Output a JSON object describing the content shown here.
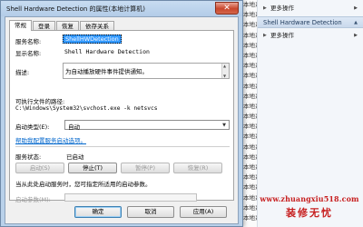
{
  "background": {
    "service_rows": [
      "本地系统",
      "本地系统",
      "本地系统",
      "本地系统",
      "本地系统",
      "本地系统",
      "本地系统",
      "本地系统",
      "本地系统",
      "本地系统",
      "本地系统",
      "本地系统",
      "本地系统",
      "本地系统",
      "本地系统",
      "本地系统",
      "本地系统",
      "本地系统",
      "本地系统",
      "本地系统",
      "本地系统",
      "本地系统"
    ],
    "actions": {
      "more_top": "更多操作",
      "section_title": "Shell Hardware Detection",
      "more_section": "更多操作"
    },
    "watermark": {
      "url": "www.zhuangxiu518.com",
      "brand": "装修无忧"
    }
  },
  "dialog": {
    "title": "Shell Hardware Detection 的属性(本地计算机)",
    "close_glyph": "✕",
    "tabs": [
      "常规",
      "登录",
      "恢复",
      "依存关系"
    ],
    "general": {
      "service_name_label": "服务名称:",
      "service_name": "ShellHWDetection",
      "display_name_label": "显示名称:",
      "display_name": "Shell Hardware Detection",
      "description_label": "描述:",
      "description": "为自动播放硬件事件提供通知。",
      "exe_path_label": "可执行文件的路径:",
      "exe_path": "C:\\Windows\\System32\\svchost.exe -k netsvcs",
      "startup_type_label": "启动类型(E):",
      "startup_type": "自动",
      "help_link": "帮助我配置服务启动选项。",
      "status_label": "服务状态:",
      "status_value": "已启动",
      "btn_start": "启动(S)",
      "btn_stop": "停止(T)",
      "btn_pause": "暂停(P)",
      "btn_resume": "恢复(R)",
      "hint": "当从此处启动服务时，您可指定所适用的启动参数。",
      "params_label": "启动参数(M):"
    },
    "buttons": {
      "ok": "确定",
      "cancel": "取消",
      "apply": "应用(A)"
    }
  }
}
